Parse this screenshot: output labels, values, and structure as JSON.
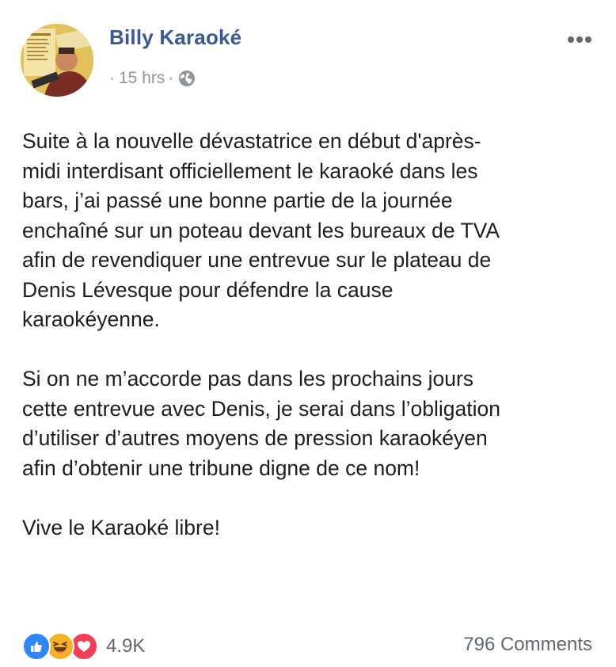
{
  "post": {
    "author": "Billy Karaoké",
    "time": "15 hrs",
    "separator": "·",
    "privacy_icon": "globe-icon",
    "more_icon": "more-options-icon",
    "paragraphs": [
      "Suite à la nouvelle dévastatrice en début d'après-\nmidi interdisant officiellement le karaoké dans les\nbars, j’ai passé une bonne partie de la journée\nenchaîné sur un poteau devant les bureaux de TVA\nafin de revendiquer une entrevue sur le plateau de\nDenis Lévesque pour défendre la cause\nkaraokéyenne.",
      "Si on ne m’accorde pas dans les prochains jours\ncette entrevue avec Denis, je serai dans l’obligation\nd’utiliser d’autres moyens de pression karaokéyen\nafin d’obtenir une tribune digne de ce nom!",
      "Vive le Karaoké libre!"
    ]
  },
  "footer": {
    "reactions": [
      "like-icon",
      "haha-icon",
      "love-icon"
    ],
    "reaction_count": "4.9K",
    "comments": "796 Comments"
  },
  "colors": {
    "author": "#385898",
    "meta": "#90949c",
    "like": "#2d88ff",
    "haha": "#f7b125",
    "love": "#f33e58"
  }
}
